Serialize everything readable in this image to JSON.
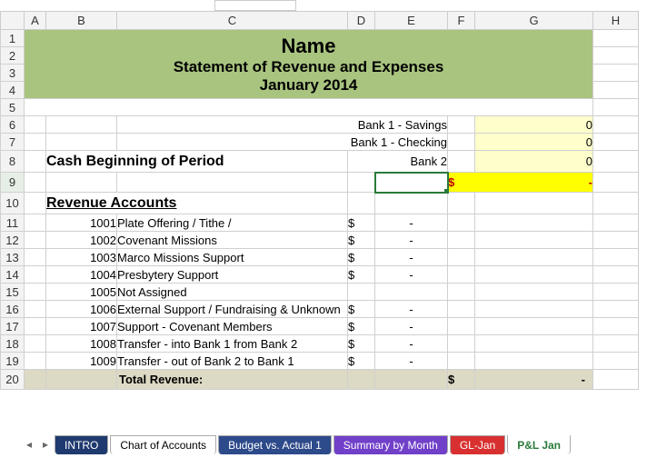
{
  "columns": [
    "",
    "A",
    "B",
    "C",
    "D",
    "E",
    "F",
    "G",
    "H"
  ],
  "title": {
    "name": "Name",
    "stmt": "Statement of Revenue and Expenses",
    "period": "January  2014"
  },
  "banks": [
    {
      "label": "Bank 1 - Savings",
      "value": "0"
    },
    {
      "label": "Bank 1 - Checking",
      "value": "0"
    },
    {
      "label": "Bank 2",
      "value": "0"
    }
  ],
  "cash_beginning_label": "Cash Beginning of Period",
  "cash_sum": {
    "sym": "$",
    "dash": "-"
  },
  "revenue_header": "Revenue Accounts",
  "revenue": [
    {
      "num": "1001",
      "name": "Plate Offering / Tithe /"
    },
    {
      "num": "1002",
      "name": "Covenant Missions"
    },
    {
      "num": "1003",
      "name": "Marco Missions Support"
    },
    {
      "num": "1004",
      "name": "Presbytery Support"
    },
    {
      "num": "1005",
      "name": "Not Assigned"
    },
    {
      "num": "1006",
      "name": "External Support / Fundraising & Unknown"
    },
    {
      "num": "1007",
      "name": "Support - Covenant Members"
    },
    {
      "num": "1008",
      "name": "Transfer - into Bank 1 from Bank 2"
    },
    {
      "num": "1009",
      "name": "Transfer - out of Bank 2 to Bank 1"
    }
  ],
  "amount": {
    "sym": "$",
    "dash": "-"
  },
  "total_revenue_label": "Total Revenue:",
  "total_revenue": {
    "sym": "$",
    "dash": "-"
  },
  "tabs": {
    "intro": "INTRO",
    "coa": "Chart of Accounts",
    "bva": "Budget vs. Actual 1",
    "sbm": "Summary by Month",
    "gljan": "GL-Jan",
    "pljan": "P&L Jan"
  },
  "selected_cell_ref": "E9"
}
